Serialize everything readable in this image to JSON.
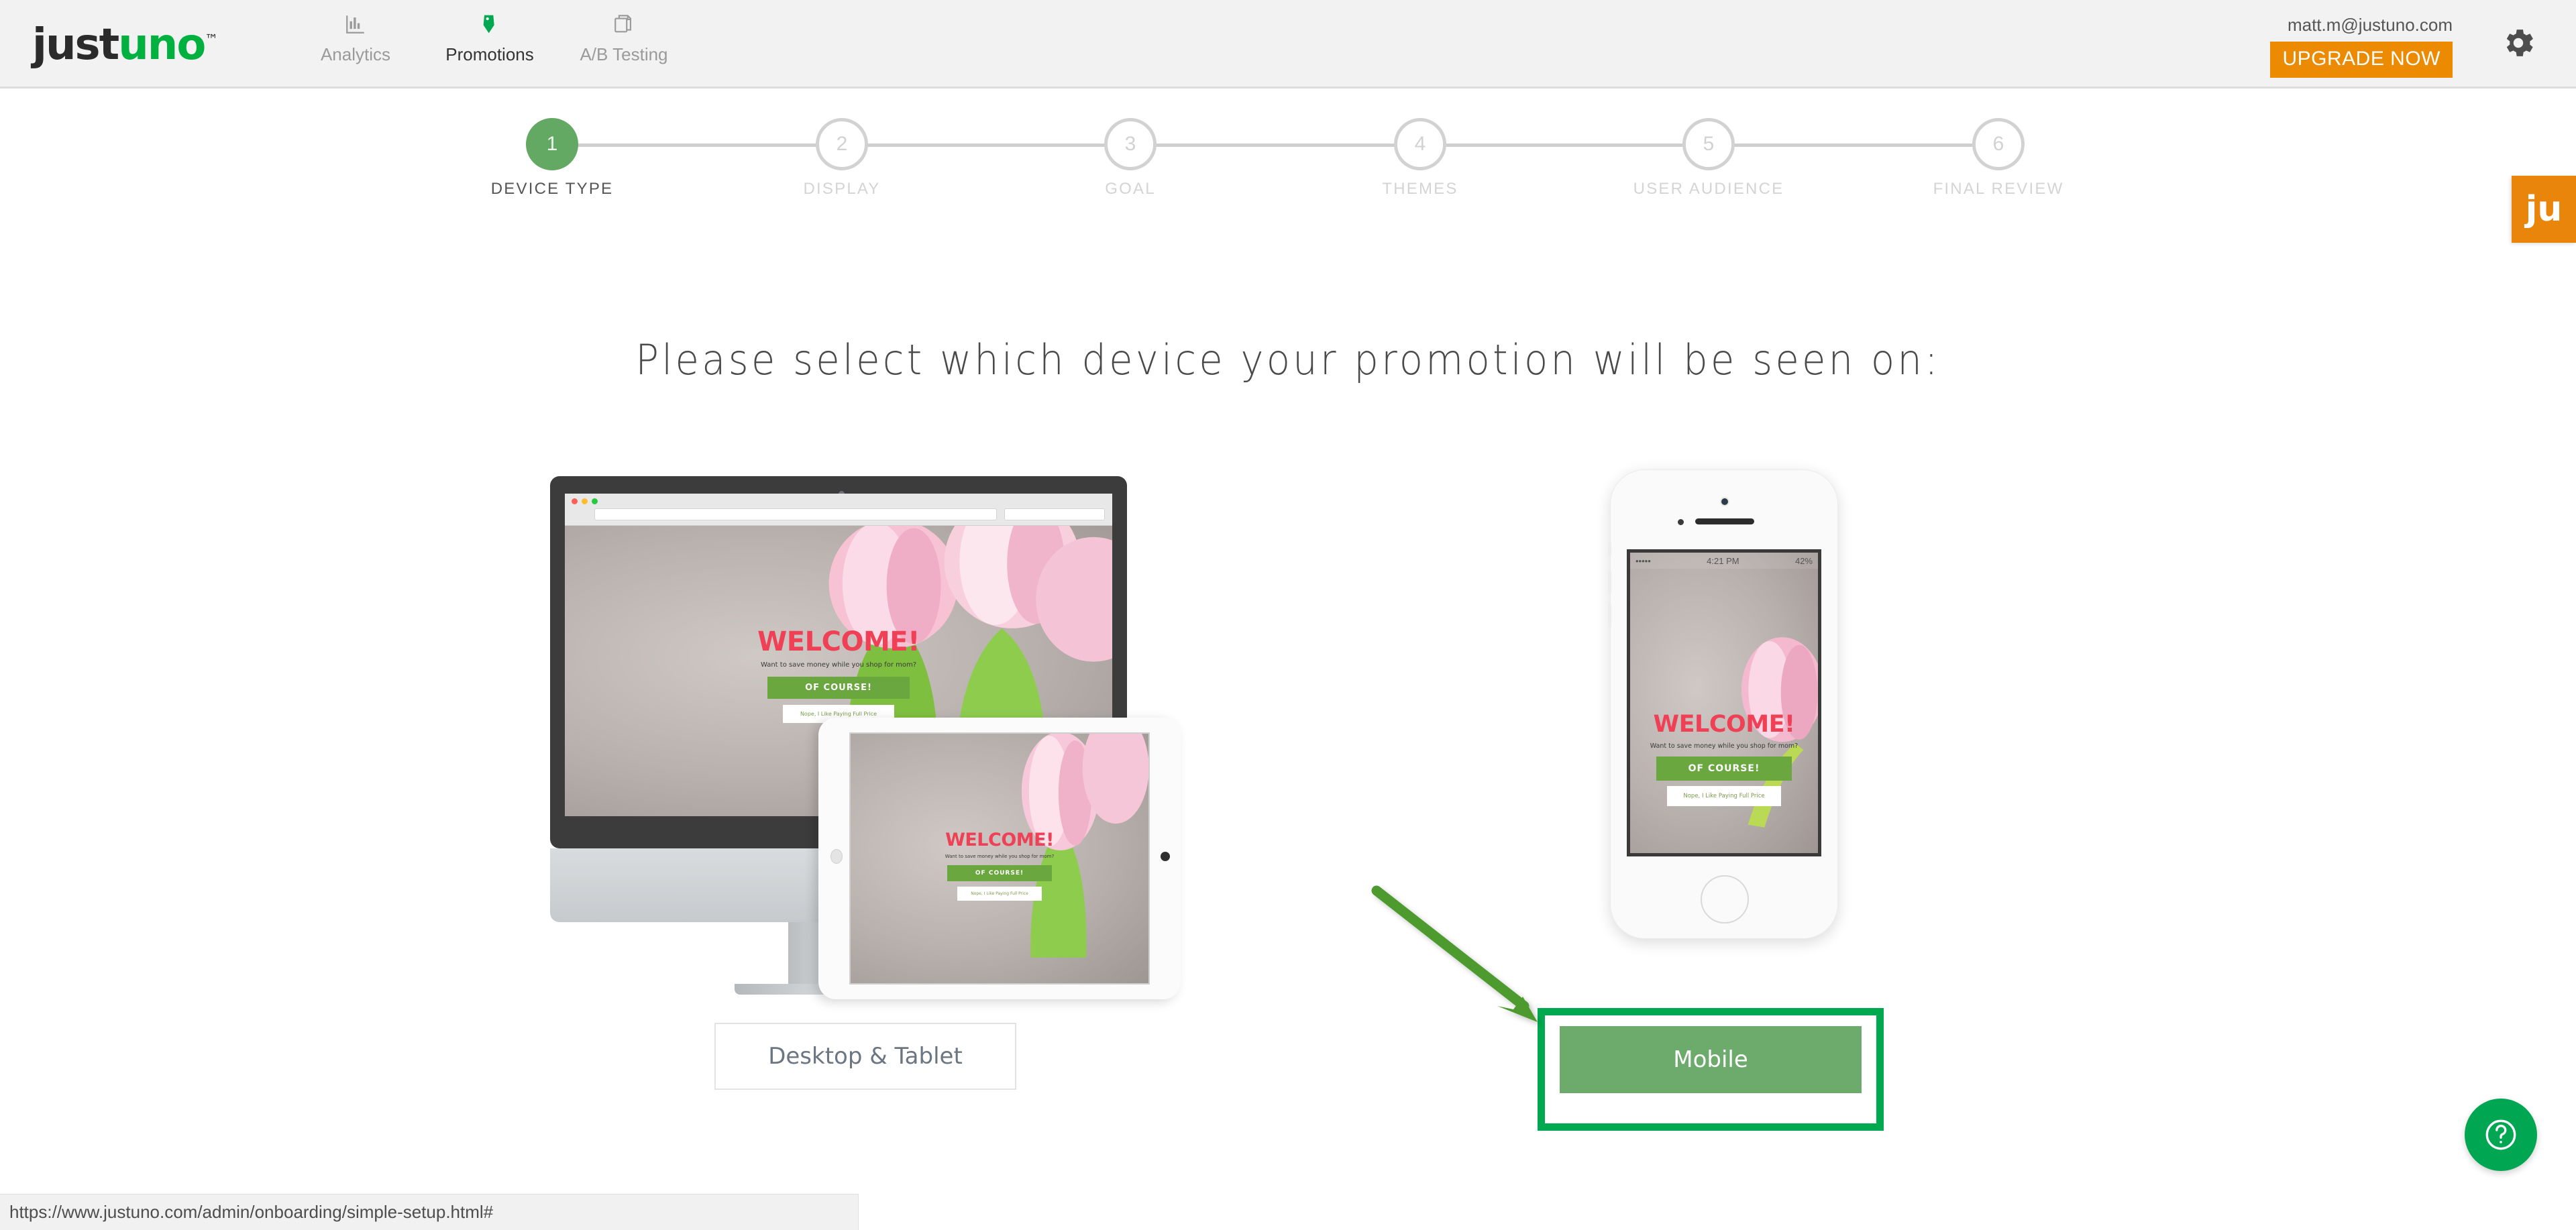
{
  "topnav": {
    "logo_part1": "just",
    "logo_part2": "uno",
    "logo_tm": "™",
    "items": [
      {
        "label": "Analytics",
        "icon": "bar-chart-icon",
        "active": false
      },
      {
        "label": "Promotions",
        "icon": "tag-icon",
        "active": true
      },
      {
        "label": "A/B Testing",
        "icon": "copy-pages-icon",
        "active": false
      }
    ],
    "user_email": "matt.m@justuno.com",
    "upgrade_label": "UPGRADE NOW",
    "settings_icon": "gear-icon",
    "upgrade_color": "#ec8a02"
  },
  "stepper": {
    "steps": [
      {
        "number": "1",
        "label": "DEVICE TYPE",
        "state": "active"
      },
      {
        "number": "2",
        "label": "DISPLAY",
        "state": "pending"
      },
      {
        "number": "3",
        "label": "GOAL",
        "state": "pending"
      },
      {
        "number": "4",
        "label": "THEMES",
        "state": "pending"
      },
      {
        "number": "5",
        "label": "USER AUDIENCE",
        "state": "pending"
      },
      {
        "number": "6",
        "label": "FINAL REVIEW",
        "state": "pending"
      }
    ],
    "active_color": "#63a863",
    "inactive_color": "#d2d2d2"
  },
  "main": {
    "headline": "Please select which device your promotion will be seen on:",
    "desktop_button_label": "Desktop & Tablet",
    "mobile_button_label": "Mobile",
    "mobile_button_color": "#6cab6c",
    "highlight_border_color": "#00a94f",
    "arrow_color": "#4e9b2e"
  },
  "promo_preview": {
    "headline": "WELCOME!",
    "subtext": "Want to save money while you shop for mom?",
    "cta_label": "OF COURSE!",
    "decline_label": "Nope, I Like Paying Full Price",
    "headline_color": "#ef4056",
    "cta_color": "#6aa83f"
  },
  "phone": {
    "status_time": "4:21 PM",
    "status_carrier": "•••••",
    "status_wifi": "wifi-icon",
    "status_battery": "42%"
  },
  "sidetab": {
    "label": "ju",
    "color": "#e8850a"
  },
  "help": {
    "icon": "question-mark-icon",
    "color": "#00a651"
  },
  "statusbar": {
    "url": "https://www.justuno.com/admin/onboarding/simple-setup.html#"
  }
}
